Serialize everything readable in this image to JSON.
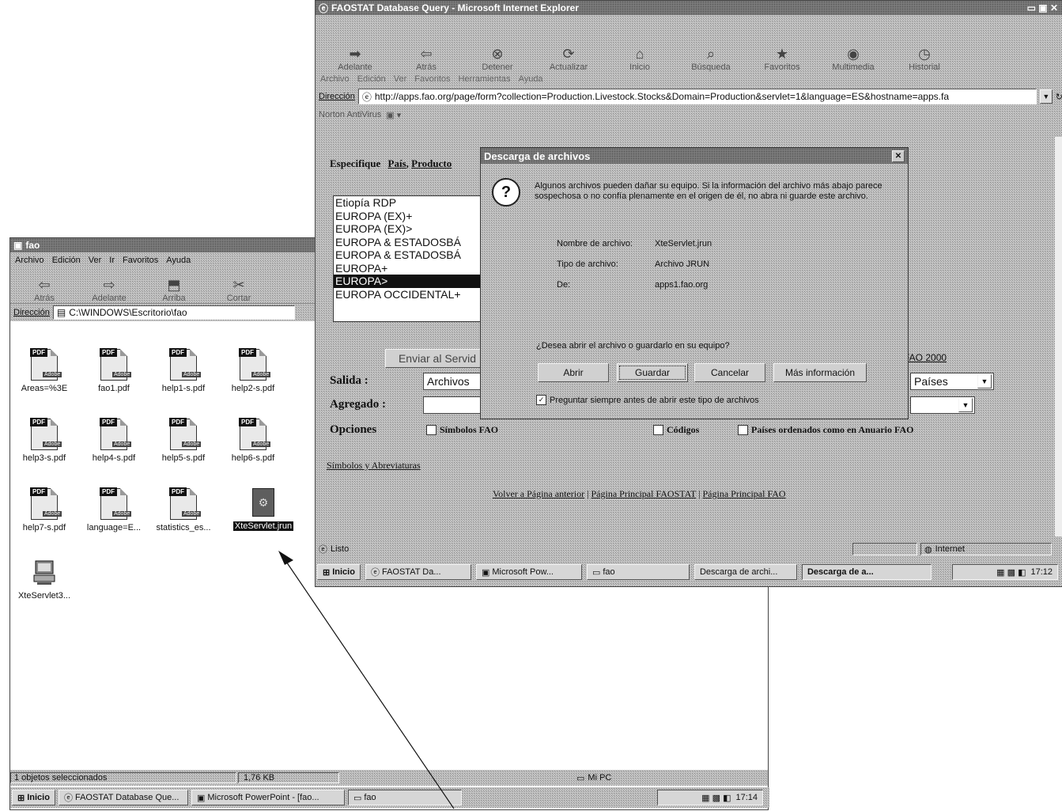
{
  "explorer": {
    "title": "fao",
    "menu": [
      "Archivo",
      "Edición",
      "Ver",
      "Ir",
      "Favoritos",
      "Ayuda"
    ],
    "toolbar": [
      {
        "label": "Atrás",
        "icon": "back-arrow-icon"
      },
      {
        "label": "Adelante",
        "icon": "forward-arrow-icon"
      },
      {
        "label": "Arriba",
        "icon": "up-folder-icon"
      },
      {
        "label": "Cortar",
        "icon": "scissors-icon"
      }
    ],
    "address_label": "Dirección",
    "address_value": "C:\\WINDOWS\\Escritorio\\fao",
    "files": [
      {
        "name": "Areas=%3E",
        "type": "pdf"
      },
      {
        "name": "fao1.pdf",
        "type": "pdf"
      },
      {
        "name": "help1-s.pdf",
        "type": "pdf"
      },
      {
        "name": "help2-s.pdf",
        "type": "pdf"
      },
      {
        "name": "help3-s.pdf",
        "type": "pdf"
      },
      {
        "name": "help4-s.pdf",
        "type": "pdf"
      },
      {
        "name": "help5-s.pdf",
        "type": "pdf"
      },
      {
        "name": "help6-s.pdf",
        "type": "pdf"
      },
      {
        "name": "help7-s.pdf",
        "type": "pdf"
      },
      {
        "name": "language=E...",
        "type": "pdf"
      },
      {
        "name": "statistics_es...",
        "type": "pdf"
      },
      {
        "name": "XteServlet.jrun",
        "type": "servlet"
      },
      {
        "name": "XteServlet3...",
        "type": "computer"
      }
    ],
    "status_left": "1 objetos seleccionados",
    "status_size": "1,76 KB",
    "status_right": "Mi PC",
    "taskbar": {
      "start": "Inicio",
      "tasks": [
        "FAOSTAT Database Que...",
        "Microsoft PowerPoint - [fao...",
        "fao"
      ],
      "clock": "17:14"
    }
  },
  "ie": {
    "title": "FAOSTAT Database Query - Microsoft Internet Explorer",
    "toolbar": [
      {
        "label": "Adelante",
        "icon": "forward-arrow-icon"
      },
      {
        "label": "Atrás",
        "icon": "back-arrow-icon"
      },
      {
        "label": "Detener",
        "icon": "stop-icon"
      },
      {
        "label": "Actualizar",
        "icon": "refresh-icon"
      },
      {
        "label": "Inicio",
        "icon": "home-icon"
      },
      {
        "label": "Búsqueda",
        "icon": "search-icon"
      },
      {
        "label": "Favoritos",
        "icon": "favorites-icon"
      },
      {
        "label": "Multimedia",
        "icon": "media-icon"
      },
      {
        "label": "Historial",
        "icon": "history-icon"
      }
    ],
    "menu": [
      "Archivo",
      "Edición",
      "Ver",
      "Favoritos",
      "Herramientas",
      "Ayuda"
    ],
    "address_label": "Dirección",
    "url": "http://apps.fao.org/page/form?collection=Production.Livestock.Stocks&Domain=Production&servlet=1&language=ES&hostname=apps.fa",
    "norton": "Norton AntiVirus",
    "page": {
      "specify_label": "Especifique",
      "specify_links": [
        "País",
        "Producto"
      ],
      "countries": [
        "Etiopía RDP",
        "EUROPA (EX)+",
        "EUROPA (EX)>",
        "EUROPA & ESTADOSBÁ",
        "EUROPA & ESTADOSBÁ",
        "EUROPA+",
        "EUROPA>",
        "EUROPA OCCIDENTAL+"
      ],
      "selected_country": "EUROPA>",
      "send_button": "Enviar al Servid",
      "fao_year": "FAO 2000",
      "output_label": "Salida :",
      "output_value": "Archivos",
      "paises_value": "Países",
      "aggregate_label": "Agregado :",
      "options_label": "Opciones",
      "opt_symbols": "Símbolos FAO",
      "opt_codes": "Códigos",
      "opt_sorted": "Países ordenados como en Anuario FAO",
      "symbols_link": "Símbolos y Abreviaturas",
      "footer_links": [
        "Volver a Página anterior",
        "Página Principal FAOSTAT",
        "Página Principal FAO"
      ]
    },
    "status_left": "Listo",
    "status_zone": "Internet",
    "taskbar": {
      "start": "Inicio",
      "tasks": [
        "FAOSTAT Da...",
        "Microsoft Pow...",
        "fao",
        "Descarga de archi...",
        "Descarga de a..."
      ],
      "clock": "17:12"
    }
  },
  "dialog": {
    "title": "Descarga de archivos",
    "message": "Algunos archivos pueden dañar su equipo. Si la información del archivo más abajo parece sospechosa o no confía plenamente en el origen de él, no abra ni guarde este archivo.",
    "file_name_label": "Nombre de archivo:",
    "file_name": "XteServlet.jrun",
    "file_type_label": "Tipo de archivo:",
    "file_type": "Archivo JRUN",
    "from_label": "De:",
    "from": "apps1.fao.org",
    "question": "¿Desea abrir el archivo o guardarlo en su equipo?",
    "buttons": [
      "Abrir",
      "Guardar",
      "Cancelar",
      "Más información"
    ],
    "checkbox_label": "Preguntar siempre antes de abrir este tipo de archivos",
    "checkbox_checked": true
  }
}
